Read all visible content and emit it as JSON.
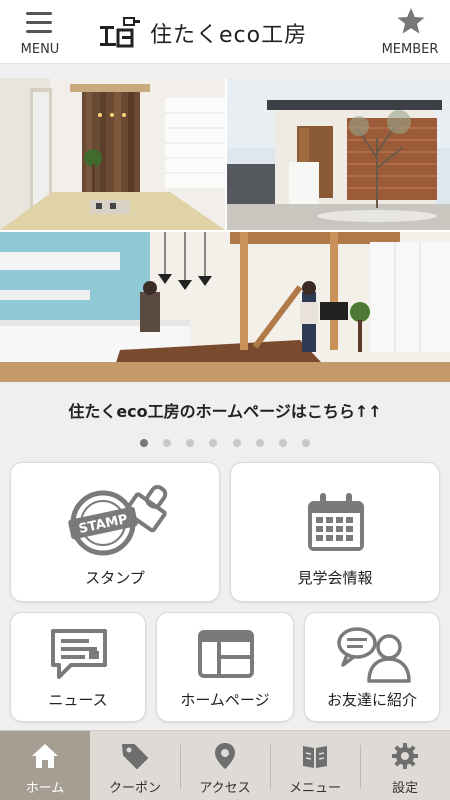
{
  "header": {
    "menu_label": "MENU",
    "member_label": "MEMBER",
    "logo_text": "住たくeco工房"
  },
  "banner": {
    "caption": "住たくeco工房のホームページはこちら↑↑",
    "slide_count": 8,
    "active_slide": 1
  },
  "tiles": {
    "stamp": {
      "label": "スタンプ",
      "icon_text": "STAMP"
    },
    "open_house": {
      "label": "見学会情報"
    },
    "news": {
      "label": "ニュース"
    },
    "homepage": {
      "label": "ホームページ"
    },
    "refer_friend": {
      "label": "お友達に紹介"
    }
  },
  "tabs": [
    {
      "label": "ホーム",
      "icon": "home-icon",
      "active": true
    },
    {
      "label": "クーポン",
      "icon": "tag-icon",
      "active": false
    },
    {
      "label": "アクセス",
      "icon": "map-pin-icon",
      "active": false
    },
    {
      "label": "メニュー",
      "icon": "book-icon",
      "active": false
    },
    {
      "label": "設定",
      "icon": "gear-icon",
      "active": false
    }
  ],
  "colors": {
    "tab_active": "#a79e93",
    "tab_bg": "#dedad6",
    "icon_gray": "#7a7a7a"
  }
}
